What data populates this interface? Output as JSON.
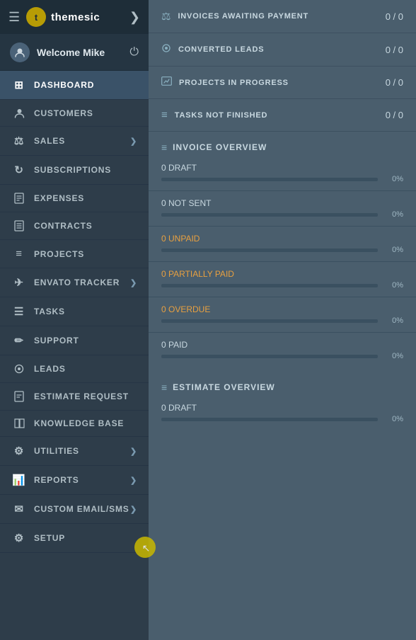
{
  "sidebar": {
    "header": {
      "logo_text": "themesic",
      "hamburger": "☰",
      "chevron": "❯"
    },
    "user": {
      "greeting": "Welcome Mike",
      "power_label": "⏻"
    },
    "nav_items": [
      {
        "id": "dashboard",
        "label": "DASHBOARD",
        "icon": "⊞",
        "active": true,
        "arrow": false
      },
      {
        "id": "customers",
        "label": "CUSTOMERS",
        "icon": "👤",
        "active": false,
        "arrow": false
      },
      {
        "id": "sales",
        "label": "SALES",
        "icon": "⚖",
        "active": false,
        "arrow": true
      },
      {
        "id": "subscriptions",
        "label": "SUBSCRIPTIONS",
        "icon": "↻",
        "active": false,
        "arrow": false
      },
      {
        "id": "expenses",
        "label": "EXPENSES",
        "icon": "📄",
        "active": false,
        "arrow": false
      },
      {
        "id": "contracts",
        "label": "CONTRACTS",
        "icon": "📋",
        "active": false,
        "arrow": false
      },
      {
        "id": "projects",
        "label": "PROJECTS",
        "icon": "≡",
        "active": false,
        "arrow": false
      },
      {
        "id": "envato-tracker",
        "label": "ENVATO TRACKER",
        "icon": "✈",
        "active": false,
        "arrow": true
      },
      {
        "id": "tasks",
        "label": "TASKS",
        "icon": "☰",
        "active": false,
        "arrow": false
      },
      {
        "id": "support",
        "label": "SUPPORT",
        "icon": "✏",
        "active": false,
        "arrow": false
      },
      {
        "id": "leads",
        "label": "LEADS",
        "icon": "⬡",
        "active": false,
        "arrow": false
      },
      {
        "id": "estimate-request",
        "label": "ESTIMATE REQUEST",
        "icon": "📋",
        "active": false,
        "arrow": false
      },
      {
        "id": "knowledge-base",
        "label": "KNOWLEDGE BASE",
        "icon": "📁",
        "active": false,
        "arrow": false
      },
      {
        "id": "utilities",
        "label": "UTILITIES",
        "icon": "⚙",
        "active": false,
        "arrow": true
      },
      {
        "id": "reports",
        "label": "REPORTS",
        "icon": "📊",
        "active": false,
        "arrow": true
      },
      {
        "id": "custom-email-sms",
        "label": "CUSTOM EMAIL/SMS",
        "icon": "✉",
        "active": false,
        "arrow": true
      },
      {
        "id": "setup",
        "label": "SETUP",
        "icon": "⚙",
        "active": false,
        "arrow": false
      }
    ]
  },
  "main": {
    "stats": [
      {
        "id": "invoices-awaiting",
        "icon": "⚖",
        "label": "INVOICES AWAITING PAYMENT",
        "value": "0 / 0"
      },
      {
        "id": "converted-leads",
        "icon": "⬡",
        "label": "CONVERTED LEADS",
        "value": "0 / 0"
      },
      {
        "id": "projects-in-progress",
        "icon": "🔧",
        "label": "PROJECTS IN PROGRESS",
        "value": "0 / 0"
      },
      {
        "id": "tasks-not-finished",
        "icon": "≡",
        "label": "TASKS NOT FINISHED",
        "value": "0 / 0"
      }
    ],
    "invoice_overview": {
      "title": "INVOICE OVERVIEW",
      "items": [
        {
          "id": "draft",
          "label": "0 DRAFT",
          "pct": "0%",
          "orange": false
        },
        {
          "id": "not-sent",
          "label": "0 NOT SENT",
          "pct": "0%",
          "orange": false
        },
        {
          "id": "unpaid",
          "label": "0 UNPAID",
          "pct": "0%",
          "orange": true
        },
        {
          "id": "partially-paid",
          "label": "0 PARTIALLY PAID",
          "pct": "0%",
          "orange": true
        },
        {
          "id": "overdue",
          "label": "0 OVERDUE",
          "pct": "0%",
          "orange": true
        },
        {
          "id": "paid",
          "label": "0 PAID",
          "pct": "0%",
          "orange": false
        }
      ]
    },
    "estimate_overview": {
      "title": "ESTIMATE OVERVIEW",
      "items": [
        {
          "id": "est-draft",
          "label": "0 DRAFT",
          "pct": "0%",
          "orange": false
        }
      ]
    }
  }
}
